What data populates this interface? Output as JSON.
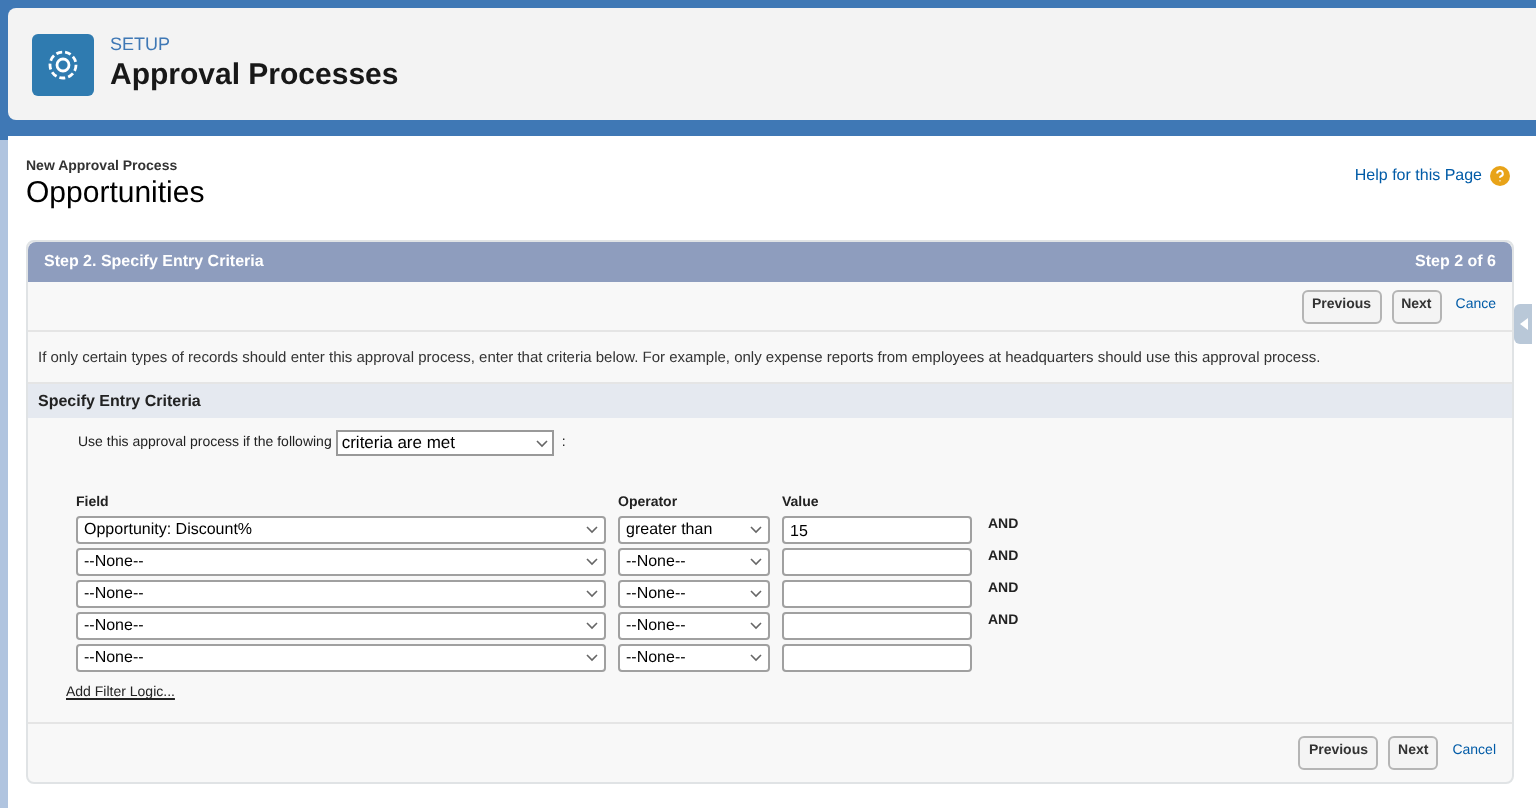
{
  "header": {
    "eyebrow": "SETUP",
    "title": "Approval Processes"
  },
  "page": {
    "breadcrumb": "New Approval Process",
    "title": "Opportunities",
    "help_link": "Help for this Page"
  },
  "step": {
    "title": "Step 2. Specify Entry Criteria",
    "counter": "Step 2 of 6"
  },
  "top_buttons": [
    {
      "kind": "button",
      "label": "Previous"
    },
    {
      "kind": "button",
      "label": "Next"
    },
    {
      "kind": "link",
      "label": "Cance"
    }
  ],
  "description": "If only certain types of records should enter this approval process, enter that criteria below. For example, only expense reports from employees at headquarters should use this approval process.",
  "section": {
    "title": "Specify Entry Criteria",
    "prompt": "Use this approval process if the following",
    "mode": "criteria are met",
    "suffix": ":"
  },
  "columns": [
    "Field",
    "Operator",
    "Value"
  ],
  "rows": [
    {
      "field": "Opportunity: Discount%",
      "operator": "greater than",
      "value": "15",
      "conjunction": "AND"
    },
    {
      "field": "--None--",
      "operator": "--None--",
      "conjunction": "AND"
    },
    {
      "field": "--None--",
      "operator": "--None--",
      "conjunction": "AND"
    },
    {
      "field": "--None--",
      "operator": "--None--",
      "conjunction": "AND"
    },
    {
      "field": "--None--",
      "operator": "--None--"
    }
  ],
  "filter_logic_link": "Add Filter Logic...",
  "bottom_buttons": [
    {
      "kind": "button",
      "label": "Previous"
    },
    {
      "kind": "button",
      "label": "Next"
    },
    {
      "kind": "link",
      "label": "Cancel"
    }
  ]
}
